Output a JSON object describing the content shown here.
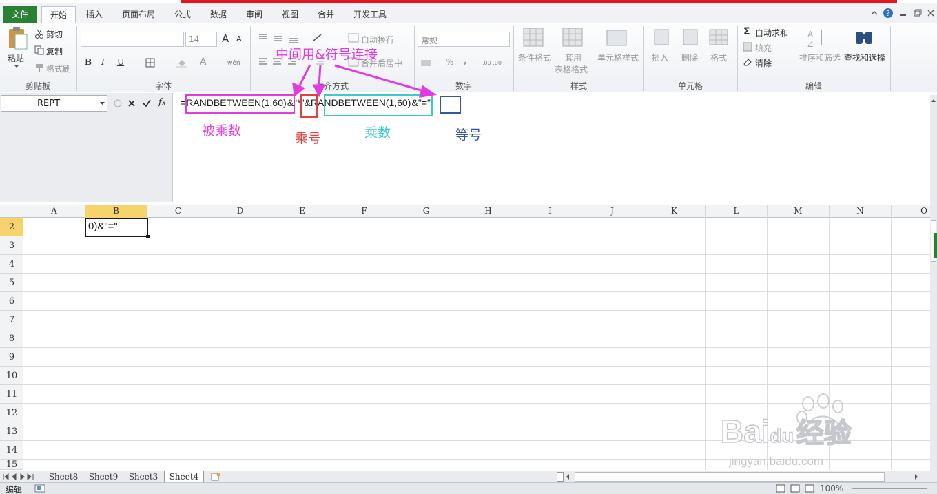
{
  "tabs": [
    "文件",
    "开始",
    "插入",
    "页面布局",
    "公式",
    "数据",
    "审阅",
    "视图",
    "合并",
    "开发工具"
  ],
  "clipboard": {
    "paste": "粘贴",
    "cut": "剪切",
    "copy": "复制",
    "format_painter": "格式刷",
    "label": "剪贴板"
  },
  "font": {
    "size": "14",
    "bold": "B",
    "italic": "I",
    "underline": "U",
    "label": "字体",
    "grow": "A",
    "shrink": "A"
  },
  "alignment": {
    "wrap": "自动换行",
    "merge": "合并后居中",
    "label": "对齐方式"
  },
  "number": {
    "format": "常规",
    "percent": "%",
    "comma": ",",
    "label": "数字"
  },
  "styles": {
    "conditional": "条件格式",
    "table": "套用",
    "table2": "表格格式",
    "cell_styles": "单元格样式",
    "label": "样式"
  },
  "cells": {
    "insert": "插入",
    "delete": "删除",
    "format": "格式",
    "label": "单元格"
  },
  "editing": {
    "autosum": "自动求和",
    "fill": "填充",
    "clear": "清除",
    "sort": "排序和筛选",
    "find": "查找和选择",
    "label": "编辑"
  },
  "namebox": "REPT",
  "formula": {
    "eq": "=",
    "part1": "RANDBETWEEN(1,60)",
    "amp1": "&",
    "part2": "\"*\"",
    "amp2": "&",
    "part3": "RANDBETWEEN(1,60)",
    "amp3": "&",
    "part4": "\"=\""
  },
  "annotations": {
    "title": "中间用&符号连接",
    "multiplicand": "被乘数",
    "times": "乘号",
    "multiplier": "乘数",
    "equals": "等号"
  },
  "columns": [
    "A",
    "B",
    "C",
    "D",
    "E",
    "F",
    "G",
    "H",
    "I",
    "J",
    "K",
    "L",
    "M",
    "N",
    "O"
  ],
  "rows": [
    "2",
    "3",
    "4",
    "5",
    "6",
    "7",
    "8",
    "9",
    "10",
    "11",
    "12",
    "13",
    "14",
    "15"
  ],
  "active_cell_text": "0)&\"=\"",
  "sheets": [
    "Sheet8",
    "Sheet9",
    "Sheet3",
    "Sheet4"
  ],
  "status": {
    "mode": "编辑",
    "zoom": "100%"
  },
  "watermark": {
    "brand": "Bai",
    "brand2": "du",
    "cn": "经验",
    "url": "jingyan.baidu.com"
  },
  "colors": {
    "magenta": "#e33be3",
    "red": "#e0433d",
    "cyan": "#3cc9cf",
    "blue": "#3356a8",
    "file_tab": "#2a8035"
  }
}
